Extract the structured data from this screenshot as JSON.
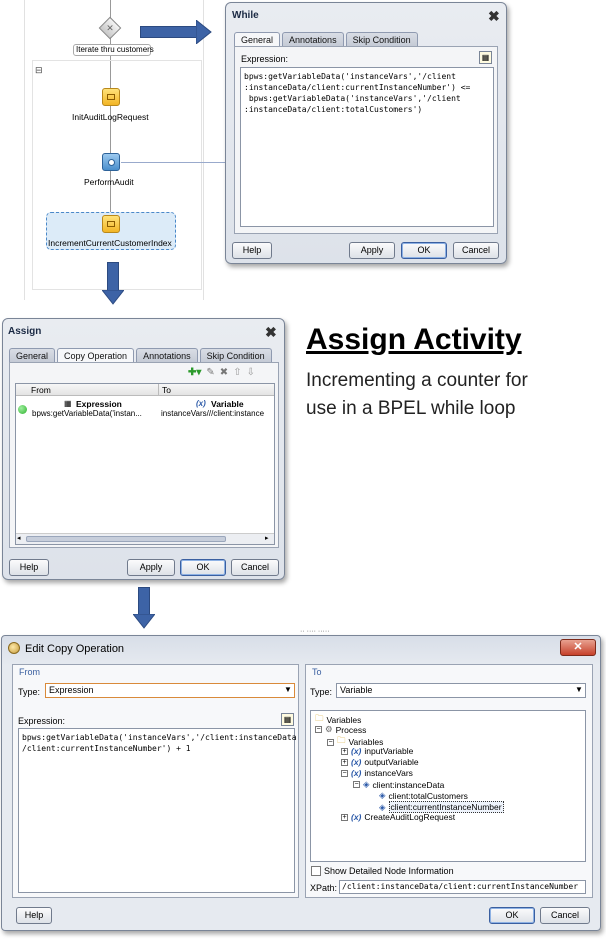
{
  "bpel": {
    "while_label": "Iterate thru customers",
    "collapse_glyph": "⊟",
    "activities": [
      "InitAuditLogRequest",
      "PerformAudit",
      "IncrementCurrentCustomerIndex"
    ]
  },
  "while_dialog": {
    "title": "While",
    "tabs": [
      "General",
      "Annotations",
      "Skip Condition"
    ],
    "expression_label": "Expression:",
    "expression": "bpws:getVariableData('instanceVars','/client\n:instanceData/client:currentInstanceNumber') <=\n bpws:getVariableData('instanceVars','/client\n:instanceData/client:totalCustomers')",
    "help": "Help",
    "apply": "Apply",
    "ok": "OK",
    "cancel": "Cancel"
  },
  "assign_dialog": {
    "title": "Assign",
    "tabs": [
      "General",
      "Copy Operation",
      "Annotations",
      "Skip Condition"
    ],
    "col_from": "From",
    "col_to": "To",
    "row_from_type": "Expression",
    "row_from_value": "bpws:getVariableData('instan...",
    "row_to_type": "Variable",
    "row_to_value": "instanceVars///client:instance",
    "help": "Help",
    "apply": "Apply",
    "ok": "OK",
    "cancel": "Cancel"
  },
  "caption": {
    "title": "Assign Activity",
    "body": "Incrementing a counter for use in a BPEL while loop"
  },
  "edit_copy": {
    "title": "Edit Copy Operation",
    "from_label": "From",
    "to_label": "To",
    "type_label": "Type:",
    "from_type": "Expression",
    "to_type": "Variable",
    "expression_label": "Expression:",
    "expression": "bpws:getVariableData('instanceVars','/client:instanceData\n/client:currentInstanceNumber') + 1",
    "tree": {
      "variables_root": "Variables",
      "process": "Process",
      "variables": "Variables",
      "input": "inputVariable",
      "output": "outputVariable",
      "instance_vars": "instanceVars",
      "instance_data": "client:instanceData",
      "total": "client:totalCustomers",
      "current": "client:currentInstanceNumber",
      "create_audit": "CreateAuditLogRequest"
    },
    "show_detailed": "Show Detailed Node Information",
    "xpath_label": "XPath:",
    "xpath": "/client:instanceData/client:currentInstanceNumber",
    "help": "Help",
    "ok": "OK",
    "cancel": "Cancel",
    "behind_text": "·· ···· ·····"
  },
  "colors": {
    "arrow": "#3d63a6",
    "accent_dialog": "#cfd6e2",
    "status_green": "#2fb12f",
    "selection_border": "#4a88c9"
  }
}
